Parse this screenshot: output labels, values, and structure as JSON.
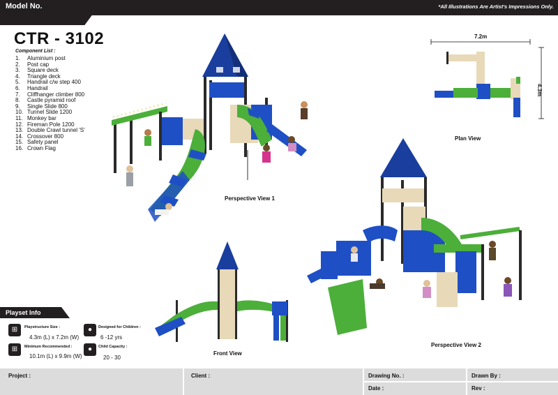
{
  "header": {
    "model_label": "Model No.",
    "disclaimer": "*All Illustrations Are Artist's Impressions Only."
  },
  "title": "CTR - 3102",
  "components": {
    "heading": "Component List :",
    "items": [
      {
        "num": "1.",
        "label": "Aluminium post"
      },
      {
        "num": "2.",
        "label": "Post cap"
      },
      {
        "num": "3.",
        "label": "Square deck"
      },
      {
        "num": "4.",
        "label": "Triangle deck"
      },
      {
        "num": "5.",
        "label": "Handrail c/w step 400"
      },
      {
        "num": "6.",
        "label": "Handrail"
      },
      {
        "num": "7.",
        "label": "Cliffhanger climber 800"
      },
      {
        "num": "8.",
        "label": "Castle pyramid roof"
      },
      {
        "num": "9.",
        "label": "Single Slide 800"
      },
      {
        "num": "10.",
        "label": "Tunnel Slide 1200"
      },
      {
        "num": "11.",
        "label": "Monkey bar"
      },
      {
        "num": "12.",
        "label": "Fireman Pole  1200"
      },
      {
        "num": "13.",
        "label": "Double Crawl tunnel 'S'"
      },
      {
        "num": "14.",
        "label": "Crossover  800"
      },
      {
        "num": "15.",
        "label": "Safety panel"
      },
      {
        "num": "16.",
        "label": "Crown Flag"
      }
    ]
  },
  "views": {
    "perspective_1": "Perspective View 1",
    "plan": "Plan View",
    "front": "Front View",
    "perspective_2": "Perspective View 2"
  },
  "plan_dims": {
    "width": "7.2m",
    "depth": "4.3m"
  },
  "playset_info": {
    "heading": "Playset Info",
    "size_label": "Playstructure Size :",
    "size_value": "4.3m (L) x 7.2m (W)",
    "min_label": "Minimum Recommended :",
    "min_value": "10.1m (L) x 9.9m (W)",
    "children_label": "Designed for Children :",
    "children_value": "6 -12 yrs",
    "capacity_label": "Child Capacity :",
    "capacity_value": "20 - 30"
  },
  "footer": {
    "project": "Project :",
    "client": "Client :",
    "drawing_no": "Drawing No. :",
    "drawn_by": "Drawn By :",
    "date": "Date :",
    "rev": "Rev :"
  },
  "colors": {
    "bar": "#231f20",
    "roof_blue": "#1a3e9e",
    "tube_green": "#4caf3a",
    "tube_blue": "#1f4fc4",
    "deck_tan": "#e8d9b8",
    "post": "#2a2a2a",
    "footer_grey": "#dcdcdc"
  }
}
